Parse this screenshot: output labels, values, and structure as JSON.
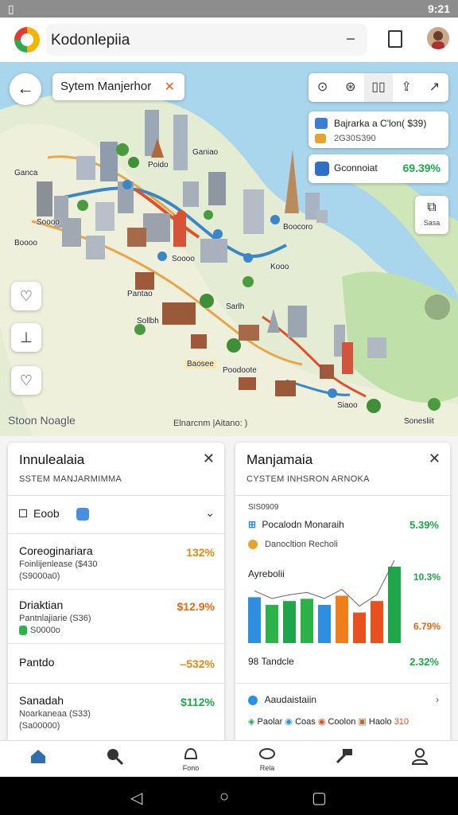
{
  "status_bar": {
    "time": "9:21"
  },
  "app_bar": {
    "title": "Kodonlepiia"
  },
  "map": {
    "route_chip_label": "Sytem Manjerhor",
    "poi_card": {
      "title": "Bajrarka a C'lon( $39)",
      "subtitle": "2G30S390"
    },
    "stat_card": {
      "label": "Gconnoiat",
      "value": "69.39%"
    },
    "layers_label": "Sasa",
    "labels": [
      "Ganiao",
      "Poido",
      "Ganca",
      "Soooo",
      "Boooo",
      "Soooo",
      "Boocoro",
      "Kooo",
      "Pantao",
      "Sarlh",
      "Sollbh",
      "Baosee",
      "Poodoote",
      "Siaoo",
      "Sonesliit"
    ],
    "attribution_left": "Stoon Noagle",
    "attribution_mid": "Elnarcnm |Aitano: )"
  },
  "left_panel": {
    "title": "Innulealaia",
    "subtitle": "SSTEM MANJARMIMMA",
    "filter_label": "Eoob",
    "items": [
      {
        "name": "Coreoginariara",
        "sub1": "Foinlijenlease ($430",
        "sub2": "(S9000a0)",
        "value": "132%",
        "color": "#e08a12"
      },
      {
        "name": "Driaktian",
        "sub1": "Pantnlajiarie (S36)",
        "sub2": "S0000o",
        "value": "$12.9%",
        "color": "#e06a1a"
      },
      {
        "name": "Pantdo",
        "sub1": "",
        "sub2": "",
        "value": "–532%",
        "color": "#e08a12"
      },
      {
        "name": "Sanadah",
        "sub1": "Noarkaneaa (S33)",
        "sub2": "(Sa00000)",
        "value": "$112%",
        "color": "#1fa64a"
      }
    ]
  },
  "right_panel": {
    "title": "Manjamaia",
    "subtitle": "CYSTEM INHSRON ARNOKA",
    "section_label": "SIS0909",
    "row1": {
      "label": "Pocalodn Monaraih",
      "value": "5.39%"
    },
    "row2": {
      "label": "Danocltion Recholi"
    },
    "chart_label": "Ayrebolii",
    "chart_value_top": "10.3%",
    "chart_value_mid": "6.79%",
    "row3": {
      "label": "Tandcle",
      "prefix": "98",
      "value": "2.32%"
    },
    "row4": {
      "label": "Aaudaistaiin"
    },
    "tags": [
      "Paolar",
      "Coas",
      "Coolon",
      "Haolo",
      "310"
    ]
  },
  "chart_data": {
    "type": "bar",
    "values": [
      6,
      5,
      5.5,
      5.8,
      5,
      6.2,
      4,
      5.5,
      10
    ],
    "colors": [
      "#2e8fe0",
      "#2db24a",
      "#1fa64a",
      "#2db24a",
      "#2e8fe0",
      "#ef7f1a",
      "#e8501f",
      "#e8501f",
      "#1fa64a"
    ]
  },
  "bottom_nav": {
    "labels": [
      "",
      "",
      "Fono",
      "Rela",
      "",
      ""
    ]
  }
}
